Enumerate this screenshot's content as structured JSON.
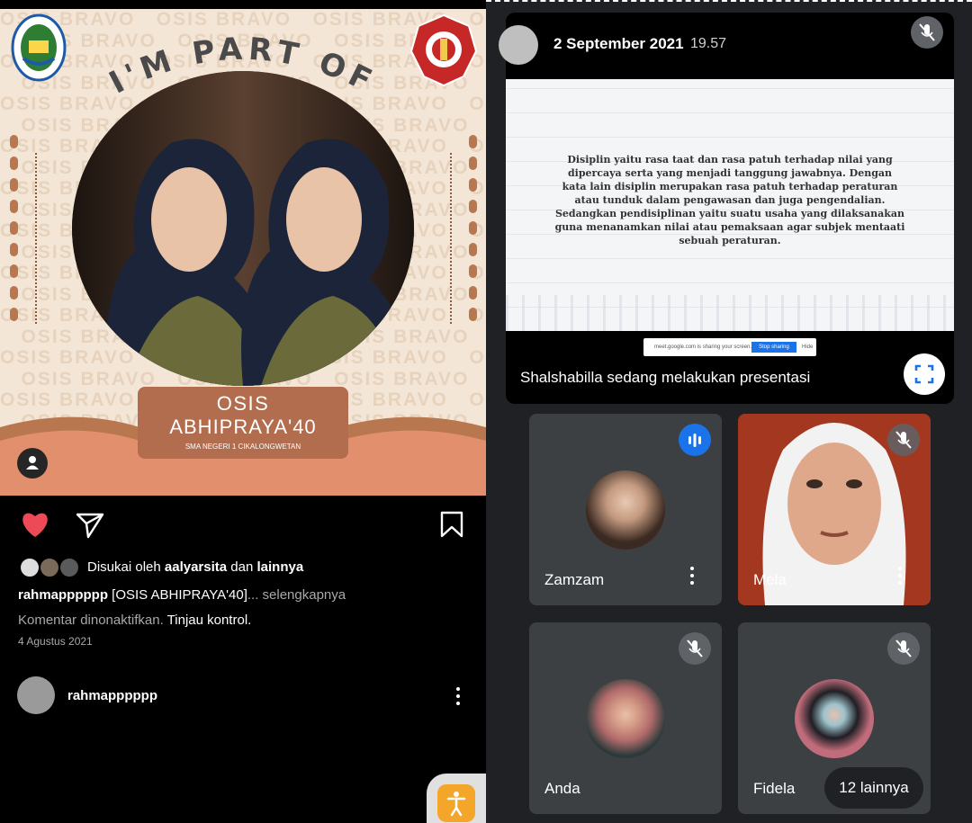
{
  "instagram": {
    "poster": {
      "headline": "I'M PART OF",
      "watermark_word": "OSIS BRAVO",
      "badge_line1": "OSIS",
      "badge_line2": "ABHIPRAYA'40",
      "badge_line3": "SMA NEGERI 1 CIKALONGWETAN"
    },
    "likes": {
      "prefix": "Disukai oleh ",
      "user": "aalyarsita",
      "middle": " dan ",
      "others": "lainnya"
    },
    "caption": {
      "user": "rahmapppppp",
      "text": " [OSIS ABHIPRAYA'40]",
      "more": "... selengkapnya"
    },
    "comments": {
      "disabled": "Komentar dinonaktifkan.",
      "review": " Tinjau kontrol."
    },
    "date": "4 Agustus 2021",
    "profile_user": "rahmapppppp",
    "colors": {
      "like": "#ed4956"
    }
  },
  "meet": {
    "header": {
      "date": "2 September 2021",
      "time": "19.57"
    },
    "slide_text": "Disiplin yaitu rasa taat dan rasa patuh terhadap nilai yang dipercaya serta yang menjadi tanggung jawabnya. Dengan kata lain disiplin merupakan rasa patuh terhadap peraturan atau tunduk dalam pengawasan dan juga pengendalian. Sedangkan pendisiplinan yaitu suatu usaha yang dilaksanakan guna menanamkan nilai atau pemaksaan agar subjek mentaati sebuah peraturan.",
    "share_bar": {
      "text": "meet.google.com is sharing your screen.",
      "stop": "Stop sharing",
      "hide": "Hide"
    },
    "presenting": "Shalshabilla sedang melakukan presentasi",
    "participants": [
      {
        "name": "Zamzam"
      },
      {
        "name": "Mela"
      },
      {
        "name": "Anda"
      },
      {
        "name": "Fidela"
      }
    ],
    "more_button": "12 lainnya",
    "colors": {
      "speaking": "#1a73e8",
      "background": "#202124"
    }
  }
}
